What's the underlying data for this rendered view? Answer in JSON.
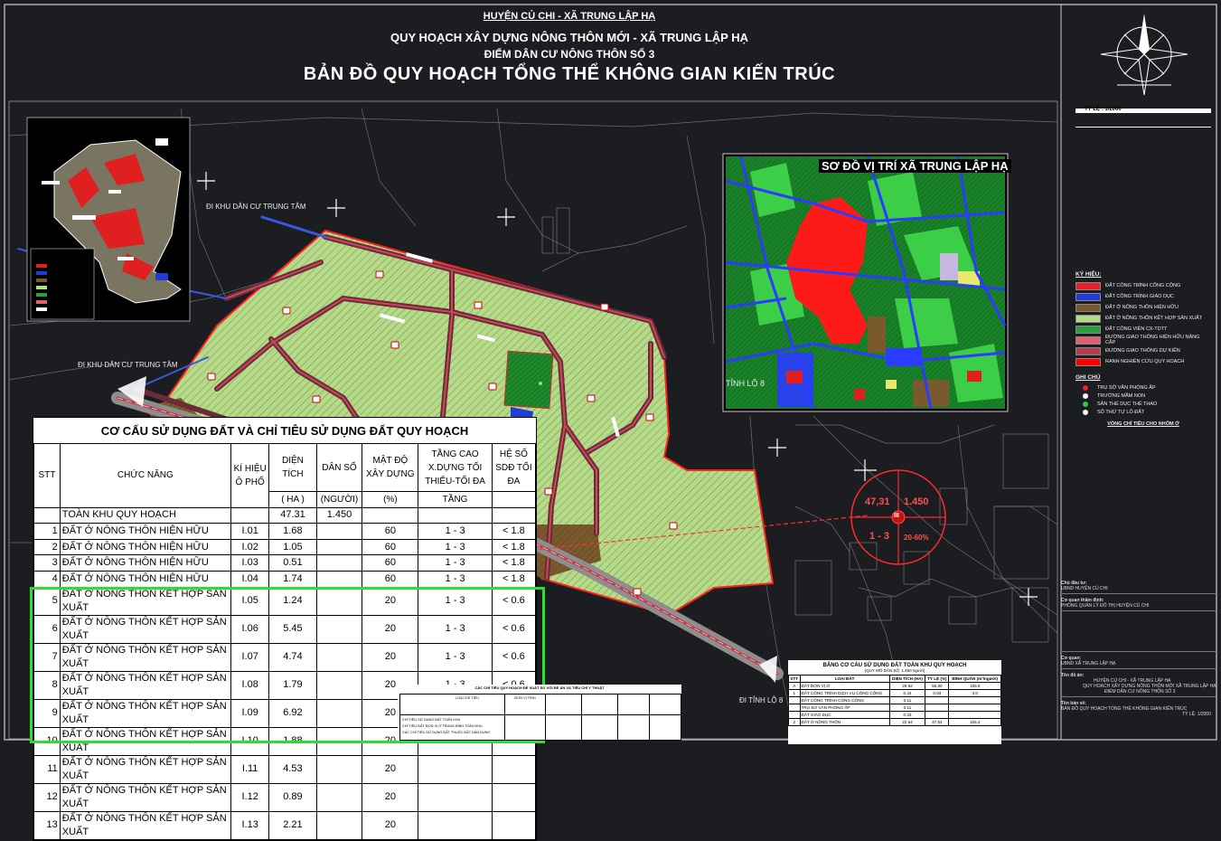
{
  "header": {
    "district_line": "HUYỆN CỦ CHI - XÃ TRUNG LẬP HẠ",
    "plan_line": "QUY HOẠCH XÂY DỰNG NÔNG THÔN MỚI - XÃ TRUNG LẬP HẠ",
    "settlement_line": "ĐIỂM DÂN CƯ NÔNG THÔN SỐ 3",
    "map_title": "BẢN ĐỒ QUY HOẠCH TỔNG THỂ KHÔNG GIAN KIẾN TRÚC"
  },
  "north_scale": "TỶ LỆ : 1/2000",
  "map_labels": {
    "to_center_top": "ĐI KHU DÂN CƯ TRUNG TÂM",
    "to_center_left": "ĐI KHU DÂN CƯ TRUNG TÂM",
    "to_road_8": "ĐI TỈNH LỘ 8",
    "inset_road": "TỈNH LỘ 8"
  },
  "inset_title": "SƠ ĐỒ VỊ TRÍ XÃ TRUNG LẬP HẠ",
  "summary_circle": {
    "area": "47,31",
    "population": "1.450",
    "floors": "1 - 3",
    "density": "20-60%",
    "zone": "III"
  },
  "legend": {
    "title": "KÝ HIỆU:",
    "items": [
      {
        "label": "ĐẤT CÔNG TRÌNH CÔNG CỘNG",
        "color": "#e8202a"
      },
      {
        "label": "ĐẤT CÔNG TRÌNH GIÁO DỤC",
        "color": "#1f3bd8"
      },
      {
        "label": "ĐẤT Ở NÔNG THÔN HIỆN HỮU",
        "color": "#7a5a2c"
      },
      {
        "label": "ĐẤT Ở NÔNG THÔN KẾT HỢP SẢN XUẤT",
        "color": "#b7d98a"
      },
      {
        "label": "ĐẤT CÔNG VIÊN CX-TDTT",
        "color": "#2e9c3a"
      },
      {
        "label": "ĐƯỜNG GIAO THÔNG HIỆN HỮU NÂNG CẤP",
        "color": "#e06070"
      },
      {
        "label": "ĐƯỜNG GIAO THÔNG DỰ KIẾN",
        "color": "#b0404e"
      },
      {
        "label": "RANH NGHIÊN CỨU QUY HOẠCH",
        "color": "#ff0000"
      }
    ],
    "notes_title": "GHI CHÚ",
    "notes": [
      {
        "label": "TRỤ SỞ VĂN PHÒNG ẤP",
        "color": "#e8202a"
      },
      {
        "label": "TRƯỜNG MẦM NON",
        "color": "#ffffff"
      },
      {
        "label": "SÂN THỂ DỤC THỂ THAO",
        "color": "#2ecc40"
      },
      {
        "label": "SỐ THỨ TỰ LÔ ĐẤT",
        "color": "#ffffff"
      }
    ],
    "indicator_note": "VÒNG CHỈ TIÊU CHO NHÓM Ở"
  },
  "main_table": {
    "caption": "CƠ CẤU SỬ DỤNG ĐẤT VÀ CHỈ TIÊU SỬ DỤNG ĐẤT QUY HOẠCH",
    "headers": {
      "stt": "STT",
      "function": "CHỨC NĂNG",
      "code": "KÍ HIỆU Ô PHỐ",
      "area": "DIỆN TÍCH",
      "area_unit": "( HA )",
      "pop": "DÂN SỐ",
      "pop_unit": "(NGƯỜI)",
      "density": "MẬT ĐỘ XÂY DỰNG",
      "density_unit": "(%)",
      "floors": "TẦNG CAO X.DỰNG TỐI THIỂU-TỐI ĐA",
      "floors_unit": "TẦNG",
      "far": "HỆ SỐ SDĐ TỐI ĐA"
    },
    "total_row": {
      "name": "TOÀN KHU QUY HOẠCH",
      "area": "47.31",
      "pop": "1.450"
    },
    "rows": [
      {
        "stt": "1",
        "name": "ĐẤT Ở NÔNG THÔN HIỆN HỮU",
        "code": "I.01",
        "area": "1.68",
        "density": "60",
        "floors": "1 - 3",
        "far": "< 1.8"
      },
      {
        "stt": "2",
        "name": "ĐẤT Ở NÔNG THÔN HIỆN HỮU",
        "code": "I.02",
        "area": "1.05",
        "density": "60",
        "floors": "1 - 3",
        "far": "< 1.8"
      },
      {
        "stt": "3",
        "name": "ĐẤT Ở NÔNG THÔN HIỆN HỮU",
        "code": "I.03",
        "area": "0.51",
        "density": "60",
        "floors": "1 - 3",
        "far": "< 1.8"
      },
      {
        "stt": "4",
        "name": "ĐẤT Ở NÔNG THÔN HIỆN HỮU",
        "code": "I.04",
        "area": "1.74",
        "density": "60",
        "floors": "1 - 3",
        "far": "< 1.8"
      },
      {
        "stt": "5",
        "name": "ĐẤT Ở NÔNG THÔN KẾT HỢP SẢN XUẤT",
        "code": "I.05",
        "area": "1.24",
        "density": "20",
        "floors": "1 - 3",
        "far": "< 0.6"
      },
      {
        "stt": "6",
        "name": "ĐẤT Ở NÔNG THÔN KẾT HỢP SẢN XUẤT",
        "code": "I.06",
        "area": "5.45",
        "density": "20",
        "floors": "1 - 3",
        "far": "< 0.6"
      },
      {
        "stt": "7",
        "name": "ĐẤT Ở NÔNG THÔN KẾT HỢP SẢN XUẤT",
        "code": "I.07",
        "area": "4.74",
        "density": "20",
        "floors": "1 - 3",
        "far": "< 0.6"
      },
      {
        "stt": "8",
        "name": "ĐẤT Ở NÔNG THÔN KẾT HỢP SẢN XUẤT",
        "code": "I.08",
        "area": "1.79",
        "density": "20",
        "floors": "1 - 3",
        "far": "< 0.6"
      },
      {
        "stt": "9",
        "name": "ĐẤT Ở NÔNG THÔN KẾT HỢP SẢN XUẤT",
        "code": "I.09",
        "area": "6.92",
        "density": "20",
        "floors": "1 - 3",
        "far": "< 0.6"
      },
      {
        "stt": "10",
        "name": "ĐẤT Ở NÔNG THÔN KẾT HỢP SẢN XUẤT",
        "code": "I.10",
        "area": "1.88",
        "density": "20",
        "floors": "1 - 3",
        "far": "< 0.6"
      },
      {
        "stt": "11",
        "name": "ĐẤT Ở NÔNG THÔN KẾT HỢP SẢN XUẤT",
        "code": "I.11",
        "area": "4.53",
        "density": "20",
        "floors": "",
        "far": ""
      },
      {
        "stt": "12",
        "name": "ĐẤT Ở NÔNG THÔN KẾT HỢP SẢN XUẤT",
        "code": "I.12",
        "area": "0.89",
        "density": "20",
        "floors": "",
        "far": ""
      },
      {
        "stt": "13",
        "name": "ĐẤT Ở NÔNG THÔN KẾT HỢP SẢN XUẤT",
        "code": "I.13",
        "area": "2.21",
        "density": "20",
        "floors": "",
        "far": ""
      }
    ]
  },
  "mini_table": {
    "caption": "CÁC CHỈ TIÊU QUY HOẠCH ĐỀ XUẤT SO VỚI ĐỀ ÁN VÀ TIÊU CHÍ Ý THUẬT",
    "col1": "LOẠI CHỈ TIÊU",
    "col2": "ĐƠN VỊ TÍNH",
    "rows": [
      "CHỈ TIÊU SỬ DỤNG ĐẤT TOÀN KHU",
      "CHỈ TIÊU ĐẤT ĐƠN VỊ Ở TRUNG BÌNH TOÀN KHU",
      "CÁC CHỈ TIÊU SỬ DỤNG ĐẤT THUỘC ĐẤT DÂN DỤNG"
    ]
  },
  "right_table": {
    "caption": "BẢNG CƠ CẤU SỬ DỤNG ĐẤT TOÀN KHU QUY HOẠCH",
    "subcaption": "(QUY MÔ DÂN SỐ: 1.450 người)",
    "headers": [
      "STT",
      "LOẠI ĐẤT",
      "DIỆN TÍCH (HA)",
      "TỶ LỆ (%)",
      "BÌNH QUÂN (m²/người)"
    ],
    "rows": [
      [
        "A",
        "ĐẤT ĐƠN VỊ Ở",
        "26.92",
        "56.90",
        "185.6"
      ],
      [
        "1",
        "ĐẤT CÔNG TRÌNH DỊCH VỤ CÔNG CỘNG",
        "0.44",
        "0.93",
        "3.0"
      ],
      [
        "",
        "ĐẤT CÔNG TRÌNH CÔNG CỘNG",
        "0.11",
        "",
        ""
      ],
      [
        "",
        "TRỤ SỞ VĂN PHÒNG ẤP",
        "0.11",
        "",
        ""
      ],
      [
        "",
        "ĐẤT GIÁO DỤC",
        "0.33",
        "",
        ""
      ],
      [
        "2",
        "ĐẤT Ở NÔNG THÔN",
        "22.54",
        "47.64",
        "155.4"
      ]
    ]
  },
  "info_block": {
    "investor_label": "Chủ đầu tư:",
    "investor": "UBND HUYỆN CỦ CHI",
    "approval_label": "Cơ quan thẩm định:",
    "approval": "PHÒNG QUẢN LÝ ĐÔ THỊ HUYỆN CỦ CHI",
    "owner_label": "Cơ quan:",
    "owner": "UBND XÃ TRUNG LẬP HẠ",
    "project_label": "Tên đồ án:",
    "project_1": "HUYỆN CỦ CHI - XÃ TRUNG LẬP HẠ",
    "project_2": "QUY HOẠCH XÂY DỰNG NÔNG THÔN MỚI XÃ TRUNG LẬP HẠ",
    "project_3": "ĐIỂM DÂN CƯ NÔNG THÔN SỐ 3",
    "sheet_label": "Tên bản vẽ:",
    "sheet": "BẢN ĐỒ QUY HOẠCH TỔNG THỂ KHÔNG GIAN KIẾN TRÚC",
    "scale": "TỶ LỆ: 1/2000"
  }
}
